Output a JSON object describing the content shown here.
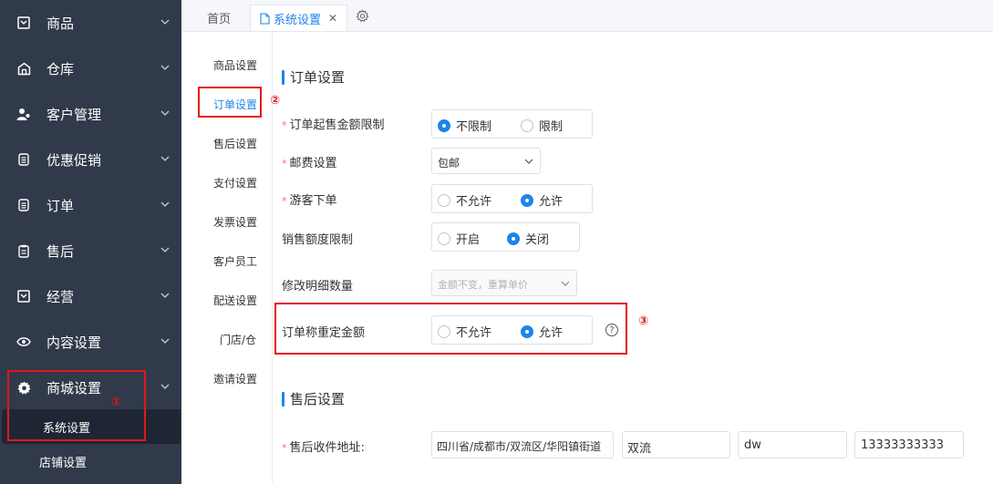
{
  "sidebar": {
    "items": [
      {
        "label": "商品",
        "icon": "box-icon"
      },
      {
        "label": "仓库",
        "icon": "warehouse-icon"
      },
      {
        "label": "客户管理",
        "icon": "user-icon"
      },
      {
        "label": "优惠促销",
        "icon": "document-icon"
      },
      {
        "label": "订单",
        "icon": "document-icon"
      },
      {
        "label": "售后",
        "icon": "clipboard-icon"
      },
      {
        "label": "经营",
        "icon": "box-icon"
      },
      {
        "label": "内容设置",
        "icon": "eye-icon"
      },
      {
        "label": "商城设置",
        "icon": "gear-icon"
      }
    ],
    "sub_items": [
      {
        "label": "系统设置"
      },
      {
        "label": "店铺设置"
      }
    ]
  },
  "tabs": {
    "home": "首页",
    "active": "系统设置",
    "close": "✕"
  },
  "setnav": [
    "商品设置",
    "订单设置",
    "售后设置",
    "支付设置",
    "发票设置",
    "客户员工",
    "配送设置",
    "门店/仓",
    "邀请设置"
  ],
  "order": {
    "title": "订单设置",
    "min_amount": {
      "label": "订单起售金额限制",
      "opt1": "不限制",
      "opt2": "限制"
    },
    "postage": {
      "label": "邮费设置",
      "value": "包邮"
    },
    "guest": {
      "label": "游客下单",
      "opt1": "不允许",
      "opt2": "允许"
    },
    "sales_limit": {
      "label": "销售额度限制",
      "opt1": "开启",
      "opt2": "关闭"
    },
    "modify_qty": {
      "label": "修改明细数量",
      "placeholder": "金额不变，重算单价"
    },
    "reweigh": {
      "label": "订单称重定金额",
      "opt1": "不允许",
      "opt2": "允许",
      "help": "?"
    }
  },
  "aftersale": {
    "title": "售后设置",
    "address_label": "售后收件地址:",
    "region": "四川省/成都市/双流区/华阳镇街道",
    "detail": "双流",
    "contact": "dw",
    "phone": "13333333333"
  },
  "annotations": {
    "n1": "①",
    "n2": "②",
    "n3": "③"
  },
  "colors": {
    "accent": "#1c85ea",
    "sidebar": "#303a4a",
    "annotation": "#e4151d"
  }
}
